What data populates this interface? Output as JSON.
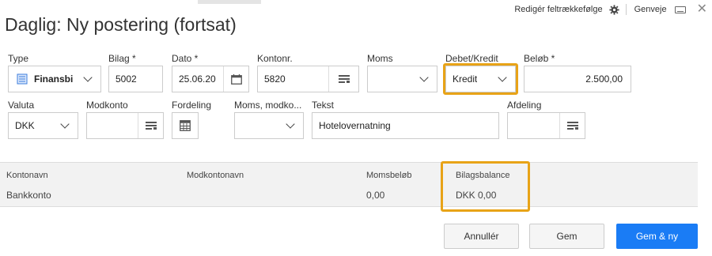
{
  "header": {
    "title": "Daglig: Ny postering (fortsat)",
    "field_order_link": "Redigér feltrækkefølge",
    "shortcuts_link": "Genveje"
  },
  "form": {
    "type": {
      "label": "Type",
      "value": "Finansbi"
    },
    "voucher": {
      "label": "Bilag *",
      "value": "5002"
    },
    "date": {
      "label": "Dato *",
      "value": "25.06.20"
    },
    "account": {
      "label": "Kontonr.",
      "value": "5820"
    },
    "vat": {
      "label": "Moms",
      "value": ""
    },
    "debit_credit": {
      "label": "Debet/Kredit",
      "value": "Kredit"
    },
    "amount": {
      "label": "Beløb *",
      "value": "2.500,00"
    },
    "currency": {
      "label": "Valuta",
      "value": "DKK"
    },
    "offset_account": {
      "label": "Modkonto",
      "value": ""
    },
    "distribution": {
      "label": "Fordeling"
    },
    "vat_offset": {
      "label": "Moms, modko...",
      "value": ""
    },
    "text": {
      "label": "Tekst",
      "value": "Hotelovernatning"
    },
    "department": {
      "label": "Afdeling",
      "value": ""
    }
  },
  "summary": {
    "account_name_label": "Kontonavn",
    "account_name_value": "Bankkonto",
    "offset_name_label": "Modkontonavn",
    "vat_amount_label": "Momsbeløb",
    "vat_amount_value": "0,00",
    "balance_label": "Bilagsbalance",
    "balance_value": "DKK 0,00"
  },
  "footer": {
    "cancel": "Annullér",
    "save": "Gem",
    "save_new": "Gem & ny"
  },
  "colors": {
    "highlight": "#e8a317",
    "primary": "#1a7cf5"
  }
}
